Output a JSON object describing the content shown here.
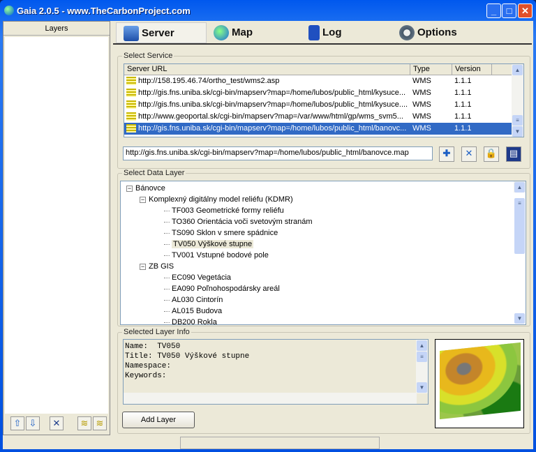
{
  "window": {
    "title": "Gaia 2.0.5 - www.TheCarbonProject.com",
    "min": "_",
    "max": "□",
    "close": "✕"
  },
  "left_panel": {
    "header": "Layers",
    "buttons": [
      "up-arrow",
      "down-arrow",
      "delete",
      "layer-group",
      "layer-export"
    ]
  },
  "tabs": [
    {
      "label": "Server",
      "icon": "server-icon"
    },
    {
      "label": "Map",
      "icon": "globe-icon"
    },
    {
      "label": "Log",
      "icon": "log-icon"
    },
    {
      "label": "Options",
      "icon": "options-icon"
    }
  ],
  "select_service": {
    "legend": "Select Service",
    "columns": [
      "Server URL",
      "Type",
      "Version"
    ],
    "rows": [
      {
        "url": "http://158.195.46.74/ortho_test/wms2.asp",
        "type": "WMS",
        "version": "1.1.1"
      },
      {
        "url": "http://gis.fns.uniba.sk/cgi-bin/mapserv?map=/home/lubos/public_html/kysuce...",
        "type": "WMS",
        "version": "1.1.1"
      },
      {
        "url": "http://gis.fns.uniba.sk/cgi-bin/mapserv?map=/home/lubos/public_html/kysuce....",
        "type": "WMS",
        "version": "1.1.1"
      },
      {
        "url": "http://www.geoportal.sk/cgi-bin/mapserv?map=/var/www/html/gp/wms_svm5...",
        "type": "WMS",
        "version": "1.1.1"
      },
      {
        "url": "http://gis.fns.uniba.sk/cgi-bin/mapserv?map=/home/lubos/public_html/banovc...",
        "type": "WMS",
        "version": "1.1.1",
        "selected": true
      }
    ],
    "url_value": "http://gis.fns.uniba.sk/cgi-bin/mapserv?map=/home/lubos/public_html/banovce.map"
  },
  "select_layer": {
    "legend": "Select Data Layer",
    "tree": [
      {
        "label": "Bánovce",
        "level": 0,
        "expander": "−"
      },
      {
        "label": "Komplexný digitálny model reliéfu (KDMR)",
        "level": 1,
        "expander": "−"
      },
      {
        "label": "TF003 Geometrické formy reliéfu",
        "level": 2
      },
      {
        "label": "TO360 Orientácia voči svetovým stranám",
        "level": 2
      },
      {
        "label": "TS090 Sklon v smere spádnice",
        "level": 2
      },
      {
        "label": "TV050 Výškové stupne",
        "level": 2,
        "selected": true
      },
      {
        "label": "TV001 Vstupné bodové pole",
        "level": 2
      },
      {
        "label": "ZB GIS",
        "level": 1,
        "expander": "−"
      },
      {
        "label": "EC090 Vegetácia",
        "level": 2
      },
      {
        "label": "EA090 Poľnohospodársky areál",
        "level": 2
      },
      {
        "label": "AL030 Cintorín",
        "level": 2
      },
      {
        "label": "AL015 Budova",
        "level": 2
      },
      {
        "label": "DB200 Rokla",
        "level": 2
      }
    ]
  },
  "layer_info": {
    "legend": "Selected Layer Info",
    "text": "Name:  TV050\nTitle: TV050 Výškové stupne\nNamespace:\nKeywords:",
    "add_button": "Add Layer"
  }
}
